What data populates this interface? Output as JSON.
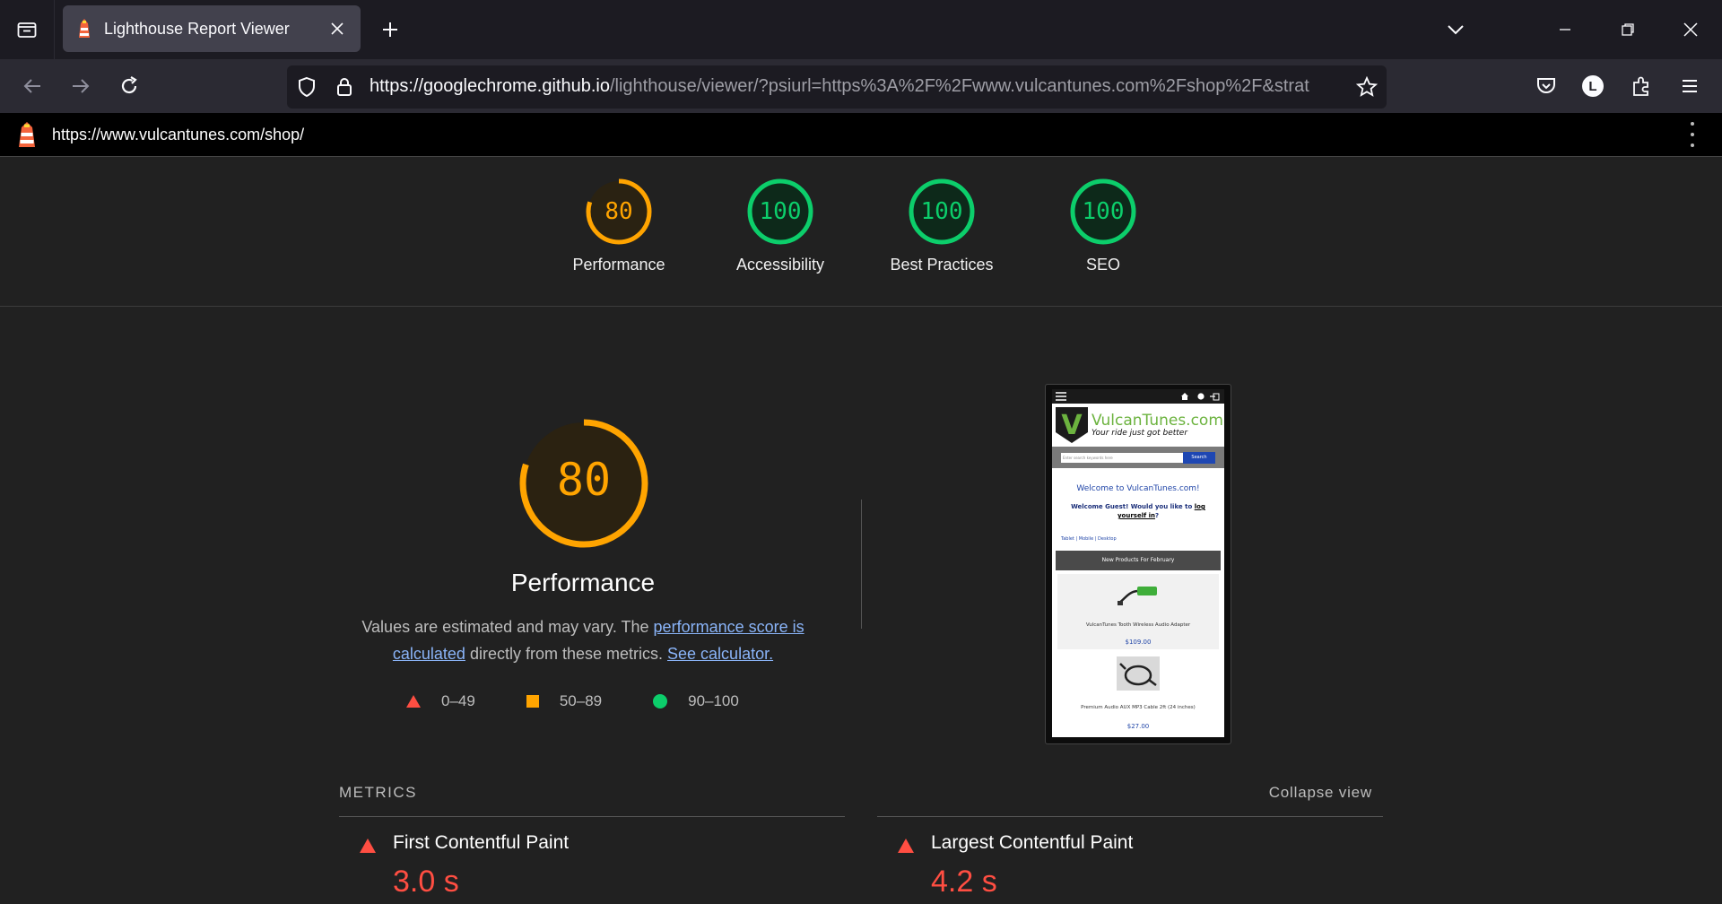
{
  "browser": {
    "tab_title": "Lighthouse Report Viewer",
    "url_host": "https://googlechrome.github.io",
    "url_rest": "/lighthouse/viewer/?psiurl=https%3A%2F%2Fwww.vulcantunes.com%2Fshop%2F&strat",
    "account_initial": "L"
  },
  "report": {
    "url": "https://www.vulcantunes.com/shop/"
  },
  "scores": [
    {
      "label": "Performance",
      "value": "80",
      "fraction": 0.8,
      "color": "#ffa400"
    },
    {
      "label": "Accessibility",
      "value": "100",
      "fraction": 1.0,
      "color": "#0cce6b"
    },
    {
      "label": "Best Practices",
      "value": "100",
      "fraction": 1.0,
      "color": "#0cce6b"
    },
    {
      "label": "SEO",
      "value": "100",
      "fraction": 1.0,
      "color": "#0cce6b"
    }
  ],
  "performance": {
    "score": "80",
    "score_fraction": 0.8,
    "title": "Performance",
    "desc_1": "Values are estimated and may vary. The ",
    "desc_link_1": "performance score is calculated",
    "desc_2": " directly from these metrics. ",
    "desc_link_2": "See calculator.",
    "legend": [
      {
        "range": "0–49",
        "color": "#ff4e42"
      },
      {
        "range": "50–89",
        "color": "#ffa400"
      },
      {
        "range": "90–100",
        "color": "#0cce6b"
      }
    ]
  },
  "screenshot": {
    "brand_name": "VulcanTunes.com",
    "tagline": "Your ride just got better",
    "search_placeholder": "Enter search keywords here",
    "search_button": "Search",
    "welcome": "Welcome to VulcanTunes.com!",
    "guest_text": "Welcome Guest! Would you like to ",
    "guest_link": "log yourself in",
    "guest_end": "?",
    "links": "Tablet | Mobile | Desktop",
    "new_products": "New Products For February",
    "product1_name": "VulcanTunes Tooth Wireless Audio Adapter",
    "product1_price": "$109.00",
    "product2_name": "Premium Audio AUX MP3 Cable 2ft (24 inches)",
    "product2_price": "$27.00"
  },
  "metrics": {
    "title": "METRICS",
    "collapse_label": "Collapse view",
    "items": [
      {
        "name": "First Contentful Paint",
        "value": "3.0 s",
        "status_color": "#ff4e42"
      },
      {
        "name": "Largest Contentful Paint",
        "value": "4.2 s",
        "status_color": "#ff4e42"
      }
    ]
  }
}
